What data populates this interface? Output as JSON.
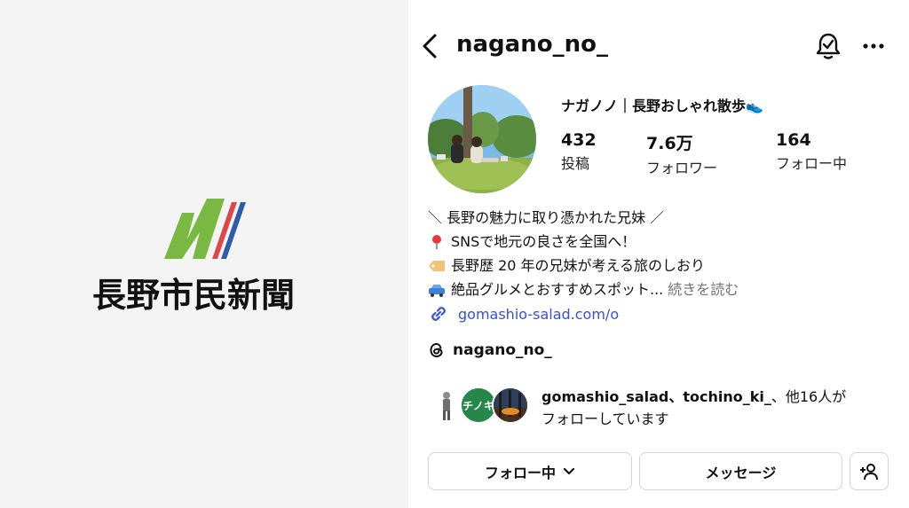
{
  "brand": {
    "name": "長野市民新聞",
    "logo_icon": "nagano-n-logo",
    "colors": {
      "green": "#7ab843",
      "red": "#d9484b",
      "blue": "#2f5ca8"
    }
  },
  "header": {
    "username": "nagano_no_",
    "back_icon": "chevron-left-icon",
    "notification_icon": "bell-check-icon",
    "more_icon": "ellipsis-icon"
  },
  "profile": {
    "display_name": "ナガノノ｜長野おしゃれ散歩👟",
    "stats": {
      "posts": {
        "value": "432",
        "label": "投稿"
      },
      "followers": {
        "value": "7.6万",
        "label": "フォロワー"
      },
      "following": {
        "value": "164",
        "label": "フォロー中"
      }
    },
    "bio": [
      {
        "emoji": "",
        "text": "＼ 長野の魅力に取り憑かれた兄妹 ／"
      },
      {
        "emoji": "pin-icon",
        "text": "SNSで地元の良さを全国へ！"
      },
      {
        "emoji": "tag-icon",
        "text": "長野歴 20 年の兄妹が考える旅のしおり"
      },
      {
        "emoji": "car-icon",
        "text": "絶品グルメとおすすめスポット..."
      }
    ],
    "more_label": "続きを読む",
    "link": "gomashio-salad.com/o",
    "threads_handle": "nagano_no_",
    "followed_by": {
      "names": "gomashio_salad、tochino_ki_",
      "suffix": "、他16人が",
      "line2": "フォローしています",
      "mini_avatar_2_text": "チノキ"
    }
  },
  "actions": {
    "following_label": "フォロー中",
    "message_label": "メッセージ",
    "add_user_icon": "add-person-icon"
  }
}
